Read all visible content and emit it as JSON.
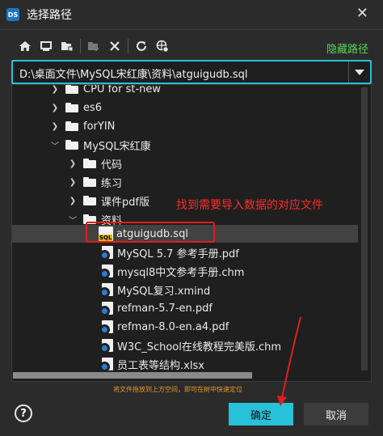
{
  "window": {
    "title": "选择路径",
    "app_icon_text": "DS"
  },
  "toolbar": {
    "hide_path_label": "隐藏路径",
    "buttons": [
      "home-icon",
      "desktop-icon",
      "folder-icon",
      "new-folder-icon",
      "delete-icon",
      "refresh-icon",
      "network-icon"
    ]
  },
  "path": {
    "value": "D:\\桌面文件\\MySQL宋红康\\资料\\atguigudb.sql"
  },
  "tree": {
    "items": [
      {
        "label": "CPU for st-new",
        "type": "folder",
        "expanded": false
      },
      {
        "label": "es6",
        "type": "folder",
        "expanded": false
      },
      {
        "label": "forYIN",
        "type": "folder",
        "expanded": false
      },
      {
        "label": "MySQL宋红康",
        "type": "folder",
        "expanded": true
      },
      {
        "label": "代码",
        "type": "folder",
        "expanded": false
      },
      {
        "label": "练习",
        "type": "folder",
        "expanded": false
      },
      {
        "label": "课件pdf版",
        "type": "folder",
        "expanded": false
      },
      {
        "label": "资料",
        "type": "folder",
        "expanded": true
      },
      {
        "label": "atguigudb.sql",
        "type": "sql",
        "selected": true
      },
      {
        "label": "MySQL 5.7 参考手册.pdf",
        "type": "file"
      },
      {
        "label": "mysql8中文参考手册.chm",
        "type": "file"
      },
      {
        "label": "MySQL复习.xmind",
        "type": "file"
      },
      {
        "label": "refman-5.7-en.pdf",
        "type": "file"
      },
      {
        "label": "refman-8.0-en.a4.pdf",
        "type": "file"
      },
      {
        "label": "W3C_School在线教程完美版.chm",
        "type": "file"
      },
      {
        "label": "员工表等结构.xlsx",
        "type": "file"
      }
    ]
  },
  "annotation": {
    "text": "找到需要导入数据的对应文件",
    "color": "#ff2a2a"
  },
  "hint": "将文件拖放到上方空间，即可在树中快速定位",
  "footer": {
    "help_label": "?",
    "ok_label": "确定",
    "cancel_label": "取消"
  },
  "colors": {
    "accent": "#27c1d9",
    "hide_path": "#59d35a",
    "hint": "#e79a2a",
    "highlight_box": "#e01e1e"
  }
}
